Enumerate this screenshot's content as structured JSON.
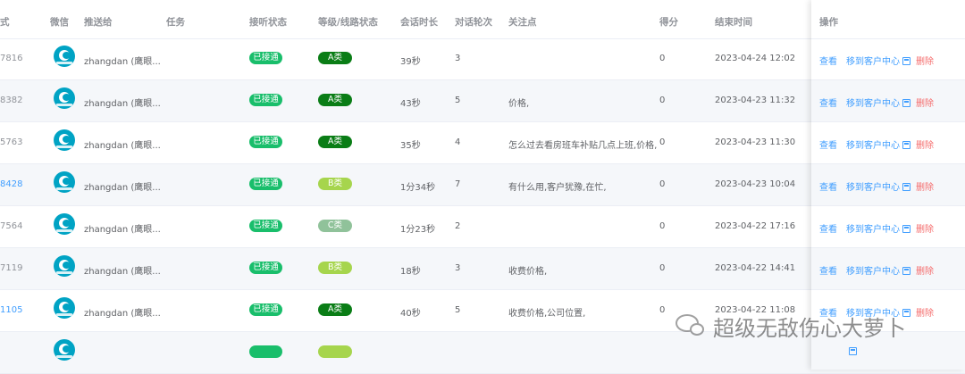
{
  "header": {
    "phone": "式",
    "wechat": "微信",
    "push_to": "推送给",
    "task": "任务",
    "answer_status": "接听状态",
    "grade_status": "等级/线路状态",
    "duration": "会话时长",
    "rounds": "对话轮次",
    "focus": "关注点",
    "score": "得分",
    "end_time": "结束时间",
    "actions": "操作"
  },
  "colors": {
    "primary": "#409eff",
    "danger": "#f56c6c",
    "success": "#19be6b",
    "gradeA": "#0a7d16",
    "gradeB": "#a6d54d",
    "gradeC": "#90c29a"
  },
  "rows": [
    {
      "phone": "7816",
      "phone_link": false,
      "push_to": "zhangdan (鹰眼...",
      "status": "已接通",
      "grade": "A类",
      "grade_key": "A",
      "duration": "39秒",
      "rounds": "3",
      "focus": "",
      "score": "0",
      "end_time": "2023-04-24 12:02",
      "view": "查看",
      "move": "移到客户中心",
      "delete": "删除"
    },
    {
      "phone": "8382",
      "phone_link": false,
      "push_to": "zhangdan (鹰眼...",
      "status": "已接通",
      "grade": "A类",
      "grade_key": "A",
      "duration": "43秒",
      "rounds": "5",
      "focus": "价格,",
      "score": "0",
      "end_time": "2023-04-23 11:32",
      "view": "查看",
      "move": "移到客户中心",
      "delete": "删除"
    },
    {
      "phone": "5763",
      "phone_link": false,
      "push_to": "zhangdan (鹰眼...",
      "status": "已接通",
      "grade": "A类",
      "grade_key": "A",
      "duration": "35秒",
      "rounds": "4",
      "focus": "怎么过去看房班车补贴几点上班,价格,",
      "score": "0",
      "end_time": "2023-04-23 11:30",
      "view": "查看",
      "move": "移到客户中心",
      "delete": "删除"
    },
    {
      "phone": "8428",
      "phone_link": true,
      "push_to": "zhangdan (鹰眼...",
      "status": "已接通",
      "grade": "B类",
      "grade_key": "B",
      "duration": "1分34秒",
      "rounds": "7",
      "focus": "有什么用,客户犹豫,在忙,",
      "score": "0",
      "end_time": "2023-04-23 10:04",
      "view": "查看",
      "move": "移到客户中心",
      "delete": "删除"
    },
    {
      "phone": "7564",
      "phone_link": false,
      "push_to": "zhangdan (鹰眼...",
      "status": "已接通",
      "grade": "C类",
      "grade_key": "C",
      "duration": "1分23秒",
      "rounds": "2",
      "focus": "",
      "score": "0",
      "end_time": "2023-04-22 17:16",
      "view": "查看",
      "move": "移到客户中心",
      "delete": "删除"
    },
    {
      "phone": "7119",
      "phone_link": false,
      "push_to": "zhangdan (鹰眼...",
      "status": "已接通",
      "grade": "B类",
      "grade_key": "B",
      "duration": "18秒",
      "rounds": "3",
      "focus": "收费价格,",
      "score": "0",
      "end_time": "2023-04-22 14:41",
      "view": "查看",
      "move": "移到客户中心",
      "delete": "删除"
    },
    {
      "phone": "1105",
      "phone_link": true,
      "push_to": "zhangdan (鹰眼...",
      "status": "已接通",
      "grade": "A类",
      "grade_key": "A",
      "duration": "40秒",
      "rounds": "5",
      "focus": "收费价格,公司位置,",
      "score": "0",
      "end_time": "2023-04-22 11:08",
      "view": "查看",
      "move": "移到客户中心",
      "delete": "删除"
    },
    {
      "phone": "",
      "phone_link": false,
      "push_to": "",
      "status": "",
      "grade": "",
      "grade_key": "B",
      "duration": "",
      "rounds": "",
      "focus": "",
      "score": "",
      "end_time": "",
      "view": "",
      "move": "",
      "delete": ""
    }
  ],
  "watermark": {
    "text": "超级无敌伤心大萝卜",
    "icon": "wechat-icon"
  }
}
